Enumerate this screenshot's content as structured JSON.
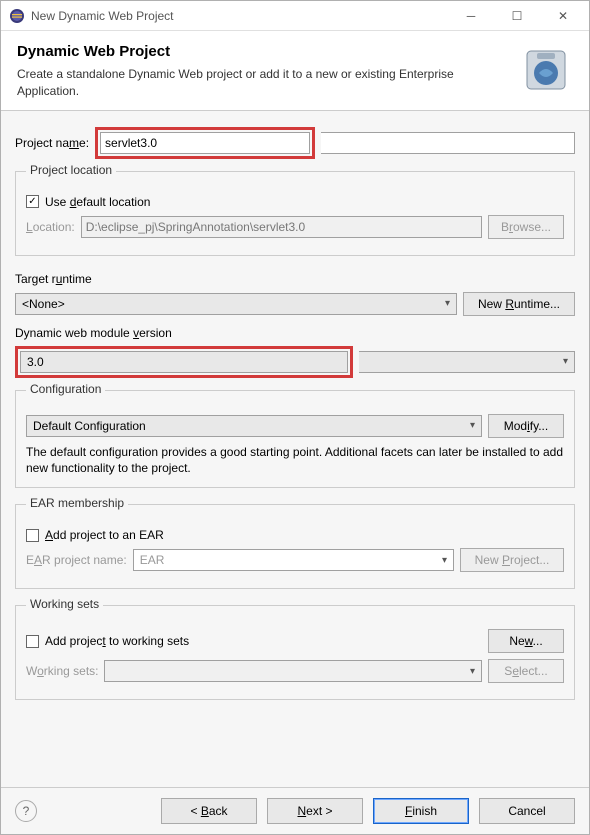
{
  "window": {
    "title": "New Dynamic Web Project"
  },
  "banner": {
    "title": "Dynamic Web Project",
    "description": "Create a standalone Dynamic Web project or add it to a new or existing Enterprise Application."
  },
  "project": {
    "name_label": "Project name:",
    "name_value": "servlet3.0"
  },
  "location": {
    "group_title": "Project location",
    "use_default_label": "Use default location",
    "use_default_checked": true,
    "location_label": "Location:",
    "location_value": "D:\\eclipse_pj\\SpringAnnotation\\servlet3.0",
    "browse_label": "Browse..."
  },
  "runtime": {
    "label": "Target runtime",
    "value": "<None>",
    "new_runtime_label": "New Runtime..."
  },
  "module": {
    "label": "Dynamic web module version",
    "value": "3.0"
  },
  "config": {
    "group_title": "Configuration",
    "value": "Default Configuration",
    "modify_label": "Modify...",
    "description": "The default configuration provides a good starting point. Additional facets can later be installed to add new functionality to the project."
  },
  "ear": {
    "group_title": "EAR membership",
    "add_label": "Add project to an EAR",
    "project_name_label": "EAR project name:",
    "project_name_value": "EAR",
    "new_project_label": "New Project..."
  },
  "working_sets": {
    "group_title": "Working sets",
    "add_label": "Add project to working sets",
    "new_label": "New...",
    "label": "Working sets:",
    "select_label": "Select..."
  },
  "footer": {
    "back": "< Back",
    "next": "Next >",
    "finish": "Finish",
    "cancel": "Cancel"
  }
}
